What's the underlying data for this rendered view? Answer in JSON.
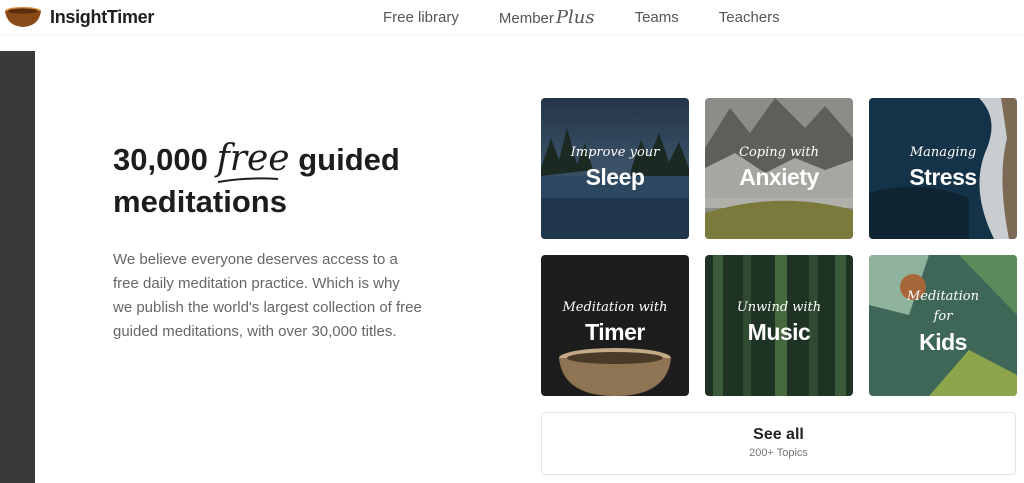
{
  "header": {
    "logo_text": "InsightTimer",
    "nav": {
      "free_library": "Free library",
      "member": "Member",
      "member_plus": "Plus",
      "teams": "Teams",
      "teachers": "Teachers"
    }
  },
  "hero": {
    "title_number": "30,000",
    "title_free": "free",
    "title_rest_1": "guided",
    "title_rest_2": "meditations",
    "body": "We believe everyone deserves access to a free daily meditation practice. Which is why we publish the world's largest collection of free guided meditations, with over 30,000 titles."
  },
  "tiles": [
    {
      "sub": "Improve your",
      "main": "Sleep"
    },
    {
      "sub": "Coping with",
      "main": "Anxiety"
    },
    {
      "sub": "Managing",
      "main": "Stress"
    },
    {
      "sub": "Meditation with",
      "main": "Timer"
    },
    {
      "sub": "Unwind with",
      "main": "Music"
    },
    {
      "sub": "Meditation",
      "sub2": "for",
      "main": "Kids"
    }
  ],
  "see_all": {
    "label": "See all",
    "count": "200+ Topics"
  }
}
